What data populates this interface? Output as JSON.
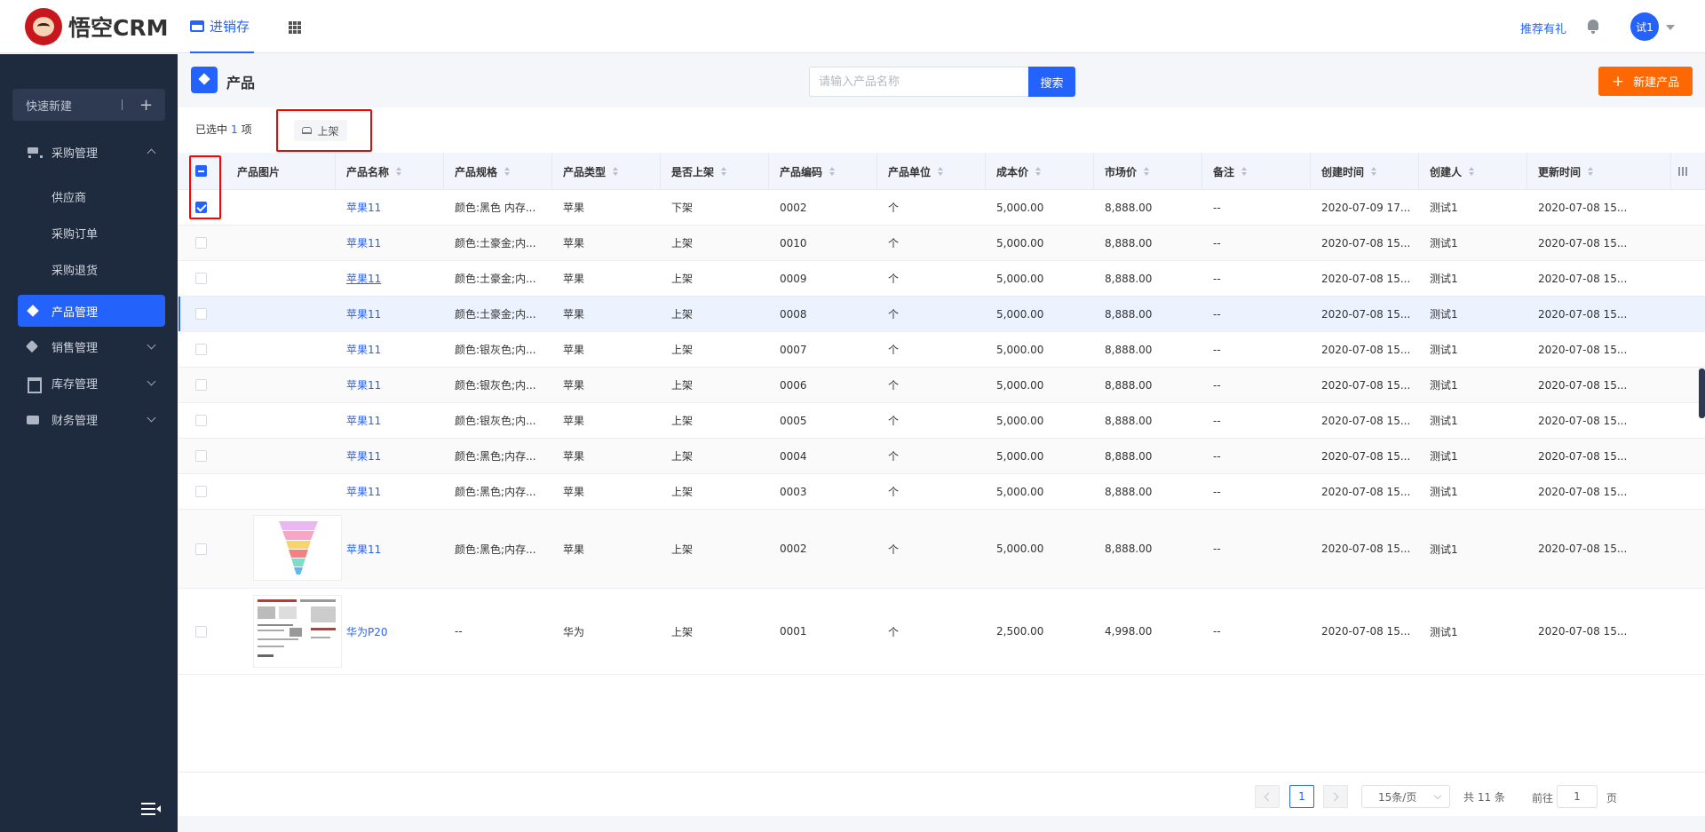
{
  "app": {
    "logo_text": "悟空CRM",
    "nav_tab": "进销存",
    "recommend": "推荐有礼",
    "avatar": "试1"
  },
  "sidebar": {
    "quick_new": "快速新建",
    "menu": [
      {
        "label": "采购管理",
        "icon": "cart-icon",
        "expanded": true
      },
      {
        "label": "产品管理",
        "icon": "cube-icon",
        "active": true
      },
      {
        "label": "销售管理",
        "icon": "tag-icon"
      },
      {
        "label": "库存管理",
        "icon": "box-icon"
      },
      {
        "label": "财务管理",
        "icon": "wallet-icon"
      }
    ],
    "sub_items": [
      "供应商",
      "采购订单",
      "采购退货"
    ]
  },
  "page": {
    "title": "产品",
    "search_placeholder": "请输入产品名称",
    "search_button": "搜索",
    "new_button": "新建产品",
    "selected_prefix": "已选中",
    "selected_count": "1",
    "selected_suffix": "项",
    "shelf_button": "上架"
  },
  "table": {
    "columns": [
      "产品图片",
      "产品名称",
      "产品规格",
      "产品类型",
      "是否上架",
      "产品编码",
      "产品单位",
      "成本价",
      "市场价",
      "备注",
      "创建时间",
      "创建人",
      "更新时间"
    ],
    "rows": [
      {
        "checked": true,
        "name": "苹果11",
        "spec": "颜色:黑色 内存...",
        "type": "苹果",
        "on_shelf": "下架",
        "code": "0002",
        "unit": "个",
        "cost": "5,000.00",
        "market": "8,888.00",
        "remark": "--",
        "created": "2020-07-09 17...",
        "creator": "测试1",
        "updated": "2020-07-08 15..."
      },
      {
        "checked": false,
        "name": "苹果11",
        "spec": "颜色:土豪金;内...",
        "type": "苹果",
        "on_shelf": "上架",
        "code": "0010",
        "unit": "个",
        "cost": "5,000.00",
        "market": "8,888.00",
        "remark": "--",
        "created": "2020-07-08 15...",
        "creator": "测试1",
        "updated": "2020-07-08 15..."
      },
      {
        "checked": false,
        "name": "苹果11",
        "spec": "颜色:土豪金;内...",
        "type": "苹果",
        "on_shelf": "上架",
        "code": "0009",
        "unit": "个",
        "cost": "5,000.00",
        "market": "8,888.00",
        "remark": "--",
        "created": "2020-07-08 15...",
        "creator": "测试1",
        "updated": "2020-07-08 15..."
      },
      {
        "checked": false,
        "name": "苹果11",
        "spec": "颜色:土豪金;内...",
        "type": "苹果",
        "on_shelf": "上架",
        "code": "0008",
        "unit": "个",
        "cost": "5,000.00",
        "market": "8,888.00",
        "remark": "--",
        "created": "2020-07-08 15...",
        "creator": "测试1",
        "updated": "2020-07-08 15..."
      },
      {
        "checked": false,
        "name": "苹果11",
        "spec": "颜色:银灰色;内...",
        "type": "苹果",
        "on_shelf": "上架",
        "code": "0007",
        "unit": "个",
        "cost": "5,000.00",
        "market": "8,888.00",
        "remark": "--",
        "created": "2020-07-08 15...",
        "creator": "测试1",
        "updated": "2020-07-08 15..."
      },
      {
        "checked": false,
        "name": "苹果11",
        "spec": "颜色:银灰色;内...",
        "type": "苹果",
        "on_shelf": "上架",
        "code": "0006",
        "unit": "个",
        "cost": "5,000.00",
        "market": "8,888.00",
        "remark": "--",
        "created": "2020-07-08 15...",
        "creator": "测试1",
        "updated": "2020-07-08 15..."
      },
      {
        "checked": false,
        "name": "苹果11",
        "spec": "颜色:银灰色;内...",
        "type": "苹果",
        "on_shelf": "上架",
        "code": "0005",
        "unit": "个",
        "cost": "5,000.00",
        "market": "8,888.00",
        "remark": "--",
        "created": "2020-07-08 15...",
        "creator": "测试1",
        "updated": "2020-07-08 15..."
      },
      {
        "checked": false,
        "name": "苹果11",
        "spec": "颜色:黑色;内存...",
        "type": "苹果",
        "on_shelf": "上架",
        "code": "0004",
        "unit": "个",
        "cost": "5,000.00",
        "market": "8,888.00",
        "remark": "--",
        "created": "2020-07-08 15...",
        "creator": "测试1",
        "updated": "2020-07-08 15..."
      },
      {
        "checked": false,
        "name": "苹果11",
        "spec": "颜色:黑色;内存...",
        "type": "苹果",
        "on_shelf": "上架",
        "code": "0003",
        "unit": "个",
        "cost": "5,000.00",
        "market": "8,888.00",
        "remark": "--",
        "created": "2020-07-08 15...",
        "creator": "测试1",
        "updated": "2020-07-08 15..."
      },
      {
        "checked": false,
        "name": "苹果11",
        "spec": "颜色:黑色;内存...",
        "type": "苹果",
        "on_shelf": "上架",
        "code": "0002",
        "unit": "个",
        "cost": "5,000.00",
        "market": "8,888.00",
        "remark": "--",
        "created": "2020-07-08 15...",
        "creator": "测试1",
        "updated": "2020-07-08 15...",
        "image": "funnel"
      },
      {
        "checked": false,
        "name": "华为P20",
        "spec": "--",
        "type": "华为",
        "on_shelf": "上架",
        "code": "0001",
        "unit": "个",
        "cost": "2,500.00",
        "market": "4,998.00",
        "remark": "--",
        "created": "2020-07-08 15...",
        "creator": "测试1",
        "updated": "2020-07-08 15...",
        "image": "document"
      }
    ]
  },
  "pagination": {
    "current": "1",
    "page_size": "15条/页",
    "total": "共 11 条",
    "goto": "前往",
    "goto_value": "1",
    "page_word": "页"
  },
  "colors": {
    "primary": "#2362fb",
    "accent": "#fd6802",
    "sidebar": "#1e2a3e"
  }
}
